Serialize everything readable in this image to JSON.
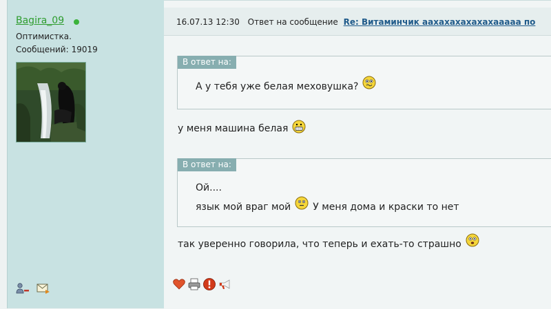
{
  "user": {
    "name": "Bagira_09",
    "title": "Оптимистка.",
    "post_count_label": "Сообщений:",
    "post_count": "19019"
  },
  "post": {
    "datetime": "16.07.13 12:30",
    "reply_label": "Ответ на сообщение",
    "reply_link": "Re: Витаминчик аахахахахахахаааaa по",
    "quote1_label": "В ответ на:",
    "quote1_text": "А у тебя уже белая меховушка?",
    "text1": "у меня машина белая",
    "quote2_label": "В ответ на:",
    "quote2_line1": "Ой....",
    "quote2_line2a": "язык мой враг мой",
    "quote2_line2b": "У меня дома и краски то нет",
    "text2": "так уверенно говорила, что теперь и ехать-то страшно"
  },
  "icons": {
    "user_actions": [
      "user-remove-icon",
      "send-message-icon"
    ],
    "post_actions": [
      "heart-icon",
      "print-icon",
      "alert-icon",
      "megaphone-icon"
    ],
    "smileys": [
      "confused-smiley-icon",
      "grin-smiley-icon",
      "blush-smiley-icon",
      "scared-smiley-icon"
    ]
  },
  "colors": {
    "username": "#2e9c2e",
    "online": "#3bb33b",
    "link": "#1f5a8a",
    "quote_label_bg": "#87aeb0",
    "user_pane_bg": "#c8e2e2"
  }
}
